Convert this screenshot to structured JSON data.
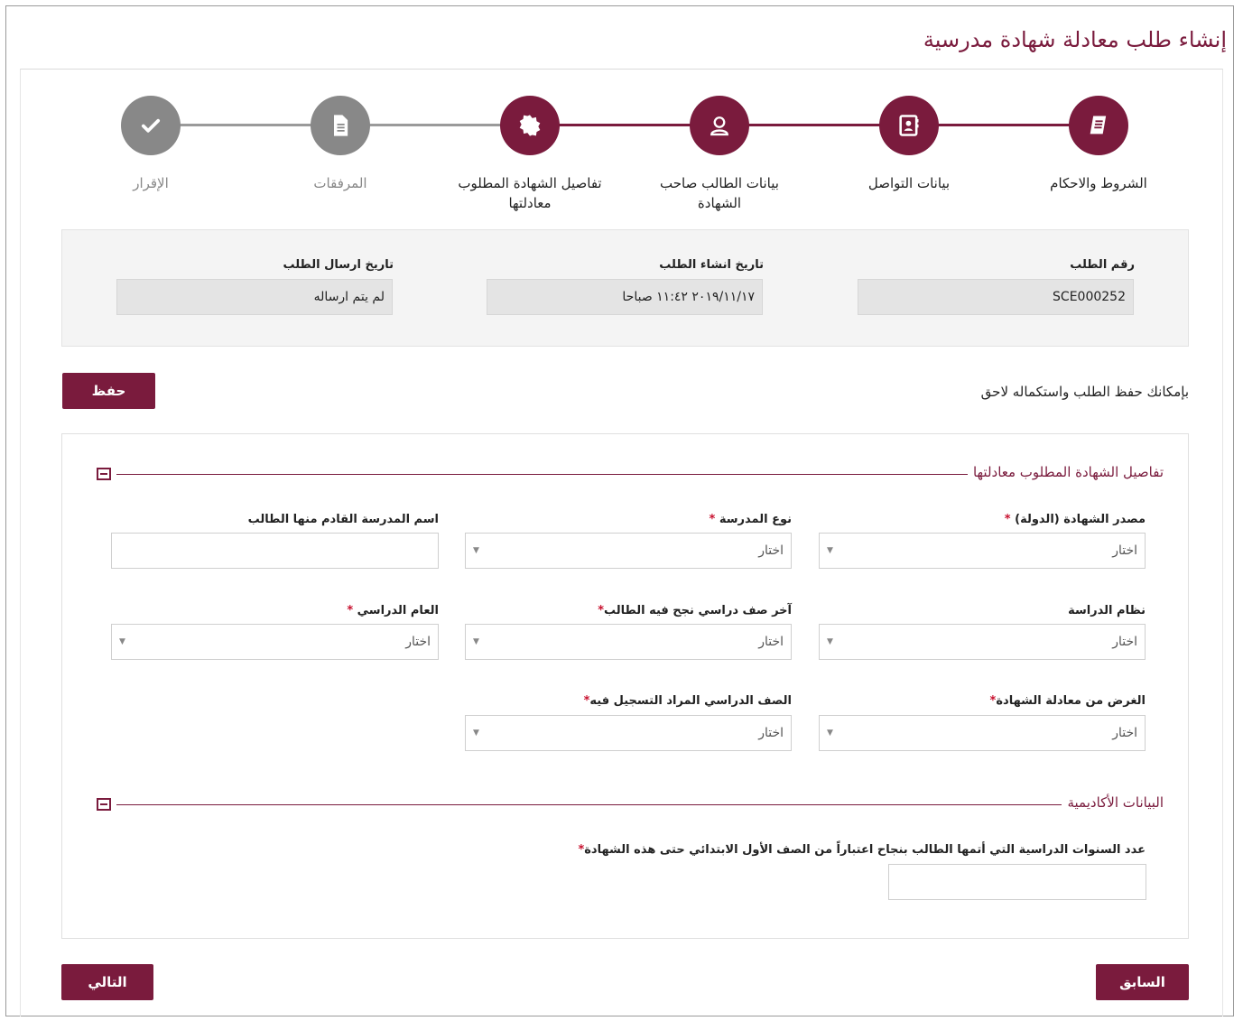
{
  "page": {
    "title": "إنشاء طلب معادلة شهادة مدرسية"
  },
  "colors": {
    "accent": "#7a1b3d",
    "inactive": "#888888",
    "required": "#c8102e"
  },
  "stepper": {
    "steps": [
      {
        "label": "الشروط والاحكام",
        "icon": "book-icon",
        "state": "active"
      },
      {
        "label": "بيانات التواصل",
        "icon": "contact-card-icon",
        "state": "active"
      },
      {
        "label": "بيانات الطالب صاحب الشهادة",
        "icon": "user-icon",
        "state": "active"
      },
      {
        "label": "تفاصيل الشهادة المطلوب معادلتها",
        "icon": "badge-icon",
        "state": "active"
      },
      {
        "label": "المرفقات",
        "icon": "document-icon",
        "state": "inactive"
      },
      {
        "label": "الإقرار",
        "icon": "checkmark-icon",
        "state": "inactive"
      }
    ]
  },
  "info": {
    "request_number_label": "رقم الطلب",
    "request_number_value": "SCE000252",
    "created_label": "تاريخ انشاء الطلب",
    "created_value": "٢٠١٩/١١/١٧ ١١:٤٢ صباحا",
    "sent_label": "تاريخ ارسال الطلب",
    "sent_value": "لم يتم ارساله"
  },
  "save": {
    "note": "بإمكانك حفظ الطلب واستكماله لاحق",
    "button": "حفظ"
  },
  "section1": {
    "title": "تفاصيل الشهادة المطلوب معادلتها",
    "fields": {
      "source_label": "مصدر الشهادة (الدولة)",
      "school_type_label": "نوع المدرسة",
      "school_name_label": "اسم المدرسة القادم منها الطالب",
      "study_system_label": "نظام الدراسة",
      "last_grade_label": "آخر صف دراسي نجح فيه الطالب",
      "academic_year_label": "العام الدراسي",
      "purpose_label": "الغرض من معادلة الشهادة",
      "target_grade_label": "الصف الدراسي المراد التسجيل فيه",
      "select_placeholder": "اختار",
      "required_mark": "*"
    }
  },
  "section2": {
    "title": "البيانات الأكاديمية",
    "years_label": "عدد السنوات الدراسية التي أتمها الطالب بنجاح اعتباراً من الصف الأول الابتدائي حتى هذه الشهادة"
  },
  "nav": {
    "prev": "السابق",
    "next": "التالي"
  }
}
